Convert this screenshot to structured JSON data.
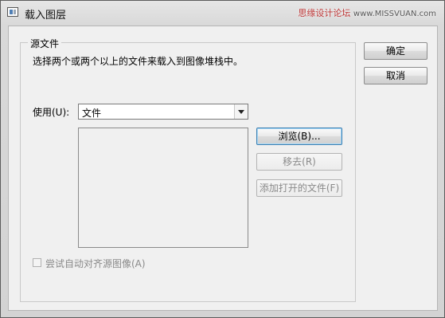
{
  "window": {
    "title": "载入图层",
    "watermark": "思缘设计论坛",
    "watermark_url": "www.MISSVUAN.com"
  },
  "source_group": {
    "legend": "源文件",
    "description": "选择两个或两个以上的文件来载入到图像堆栈中。",
    "use_label": "使用(U):",
    "use_value": "文件",
    "file_list": []
  },
  "buttons": {
    "browse": "浏览(B)...",
    "remove": "移去(R)",
    "add_open": "添加打开的文件(F)",
    "ok": "确定",
    "cancel": "取消"
  },
  "options": {
    "auto_align_label": "尝试自动对齐源图像(A)",
    "auto_align_checked": false,
    "auto_align_enabled": false
  }
}
